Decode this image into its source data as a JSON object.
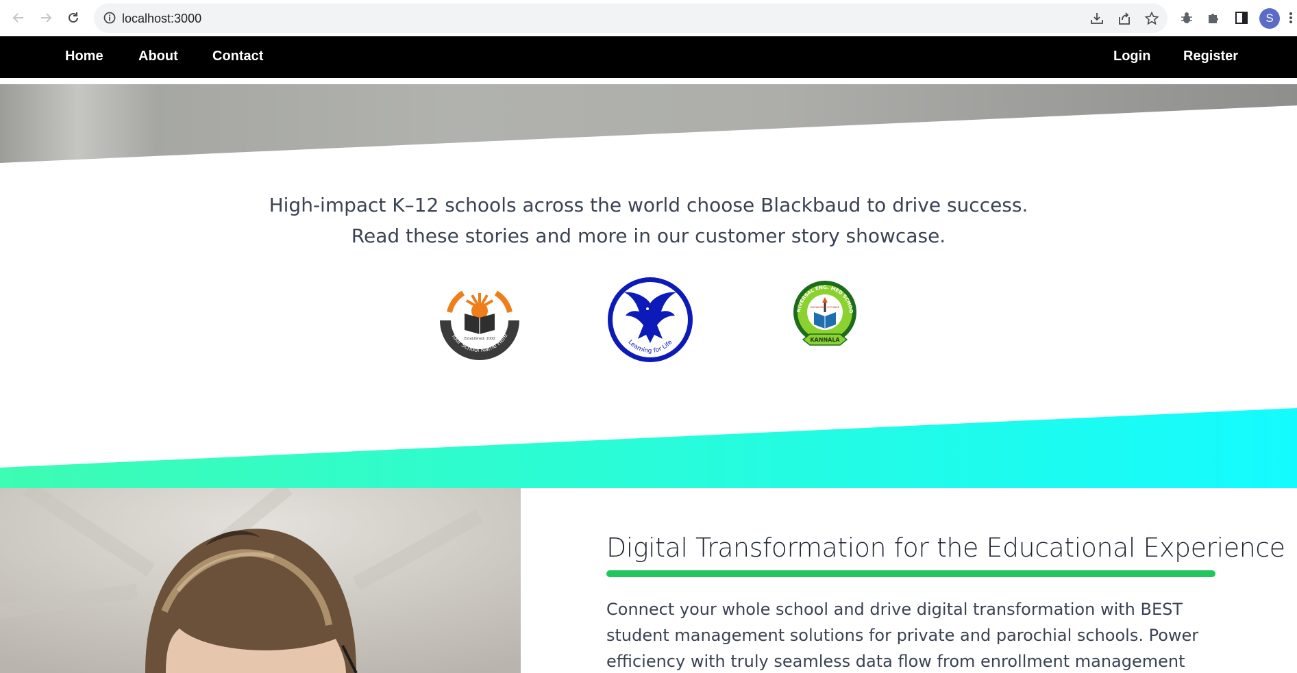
{
  "browser": {
    "url": "localhost:3000",
    "profile_initial": "S",
    "icons": [
      "back-arrow-icon",
      "forward-arrow-icon",
      "reload-icon",
      "site-info-icon",
      "install-icon",
      "share-icon",
      "bookmark-star-icon",
      "extension-bug-icon",
      "extensions-puzzle-icon",
      "side-panel-icon",
      "menu-dots-icon"
    ]
  },
  "navbar": {
    "left": [
      "Home",
      "About",
      "Contact"
    ],
    "right": [
      "Login",
      "Register"
    ]
  },
  "stories": {
    "line1": "High-impact K–12 schools across the world choose Blackbaud to drive success.",
    "line2": "Read these stories and more in our customer story showcase."
  },
  "logos": {
    "school1": {
      "established": "Established: 2000",
      "name": "Your School Name Here"
    },
    "school2": {
      "motto": "Learning for Life"
    },
    "school3": {
      "name": "UNIVERSAL ENG. MED SCHOOL",
      "motto": "KNOWLEDGE IS POWER",
      "place": "KANNALA"
    }
  },
  "feature": {
    "title": "Digital Transformation for the Educational Experience",
    "body": "Connect your whole school and drive digital transformation with BEST student management solutions for private and parochial schools. Power efficiency with truly seamless data flow from enrollment management into the learning"
  },
  "colors": {
    "navbar_bg": "#000000",
    "accent_bar": "#22c55e",
    "gradient_start": "#3dfcb3",
    "gradient_end": "#14fbff"
  }
}
